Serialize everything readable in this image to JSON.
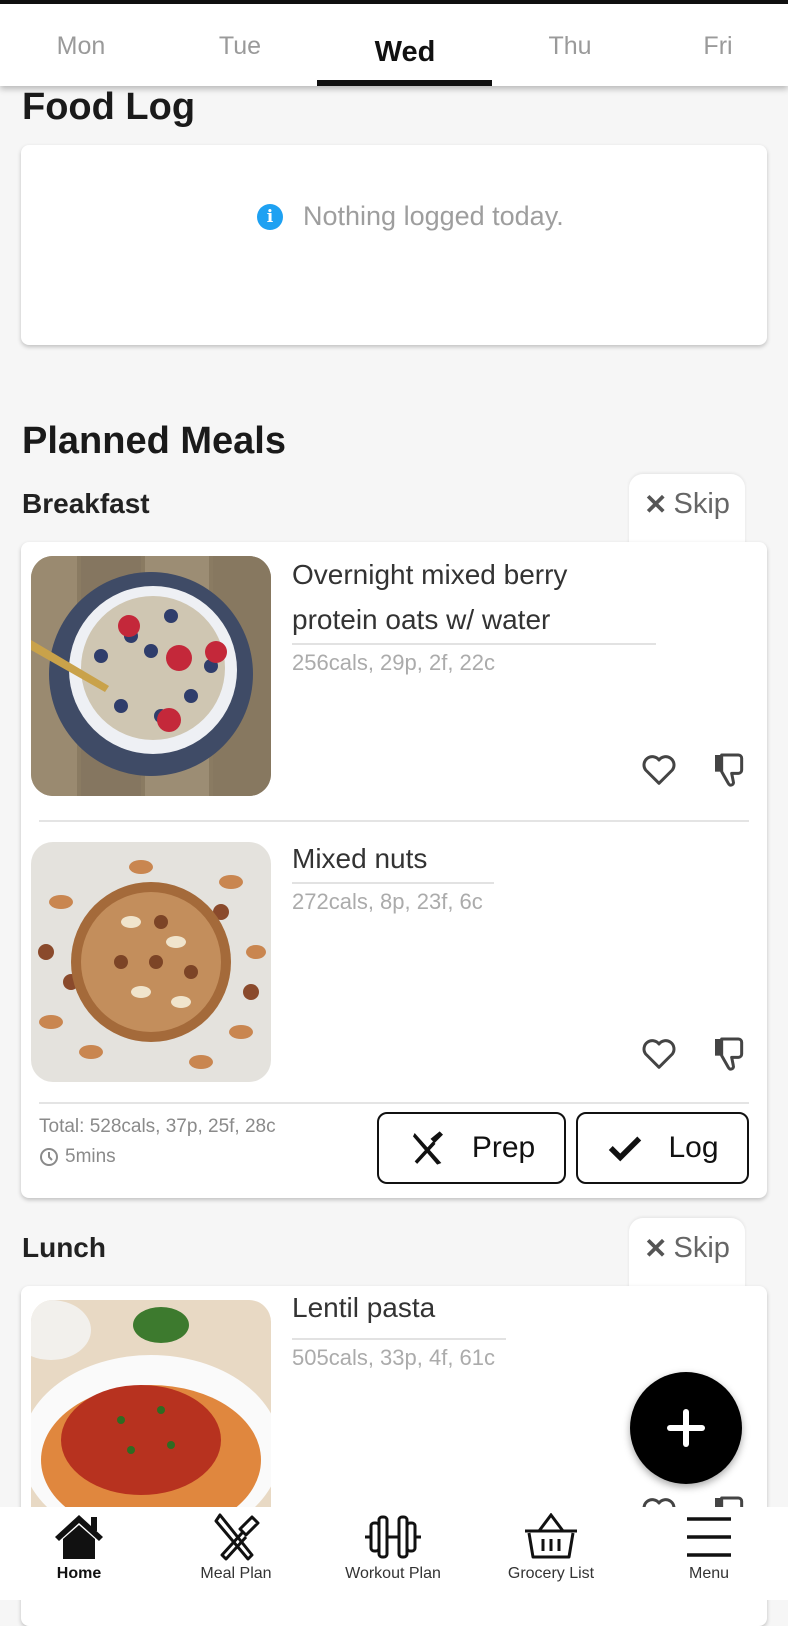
{
  "day_tabs": [
    {
      "label": "Mon",
      "active": false
    },
    {
      "label": "Tue",
      "active": false
    },
    {
      "label": "Wed",
      "active": true
    },
    {
      "label": "Thu",
      "active": false
    },
    {
      "label": "Fri",
      "active": false
    }
  ],
  "food_log": {
    "title": "Food Log",
    "empty_message": "Nothing logged today.",
    "info_icon_glyph": "i"
  },
  "planned_meals": {
    "title": "Planned Meals",
    "meals": [
      {
        "name": "Breakfast",
        "skip_label": "Skip",
        "items": [
          {
            "name_line1": "Overnight mixed berry",
            "name_line2": "protein oats w/ water",
            "macros": "256cals, 29p, 2f, 22c",
            "image": "berry-oats-bowl"
          },
          {
            "name_line1": "Mixed nuts",
            "macros": "272cals, 8p, 23f, 6c",
            "image": "mixed-nuts-bowl"
          }
        ],
        "total": "Total: 528cals, 37p, 25f, 28c",
        "prep_time": "5mins",
        "prep_label": "Prep",
        "log_label": "Log"
      },
      {
        "name": "Lunch",
        "skip_label": "Skip",
        "items": [
          {
            "name_line1": "Lentil pasta",
            "macros": "505cals, 33p, 4f, 61c",
            "image": "lentil-pasta-bowl"
          }
        ]
      }
    ]
  },
  "fab": {
    "icon": "plus-icon"
  },
  "bottom_nav": [
    {
      "label": "Home",
      "icon": "home-icon",
      "active": true
    },
    {
      "label": "Meal Plan",
      "icon": "utensils-icon",
      "active": false
    },
    {
      "label": "Workout Plan",
      "icon": "dumbbell-icon",
      "active": false
    },
    {
      "label": "Grocery List",
      "icon": "basket-icon",
      "active": false
    },
    {
      "label": "Menu",
      "icon": "menu-icon",
      "active": false
    }
  ]
}
